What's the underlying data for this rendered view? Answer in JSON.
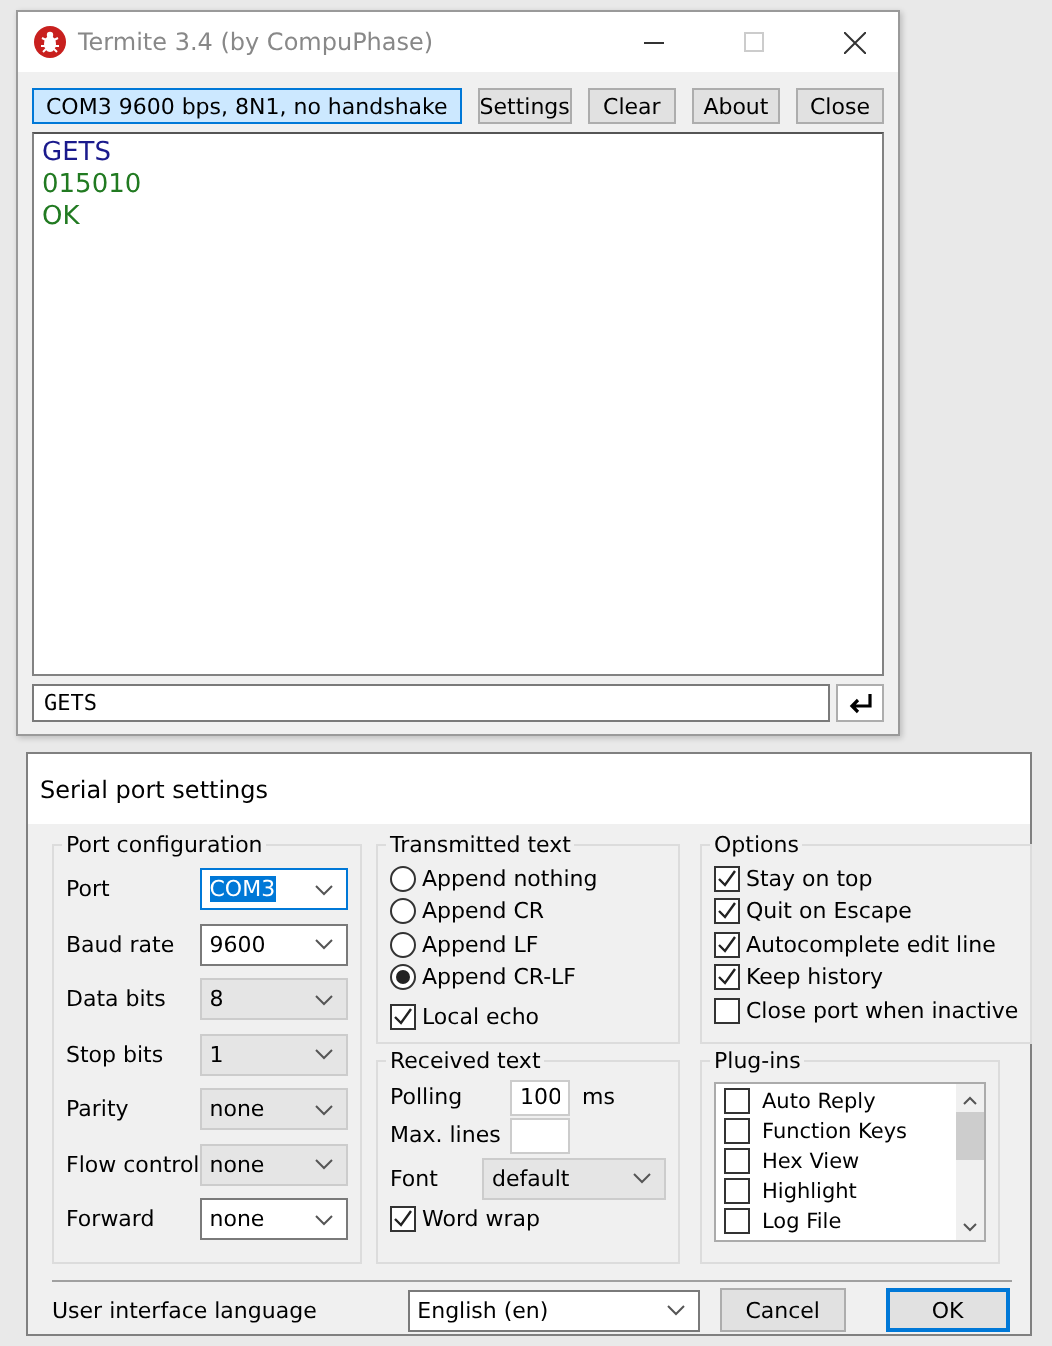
{
  "window": {
    "title": "Termite 3.4 (by CompuPhase)"
  },
  "toolbar": {
    "status": "COM3 9600 bps, 8N1, no handshake",
    "buttons": [
      "Settings",
      "Clear",
      "About",
      "Close"
    ]
  },
  "terminal": {
    "lines": [
      {
        "text": "GETS",
        "kind": "sent"
      },
      {
        "text": "015010",
        "kind": "received"
      },
      {
        "text": "OK",
        "kind": "received"
      }
    ]
  },
  "input": {
    "value": "GETS"
  },
  "dialog": {
    "title": "Serial port settings",
    "port_configuration": {
      "title": "Port configuration",
      "fields": [
        {
          "label": "Port",
          "value": "COM3",
          "disabled": false,
          "selected": true
        },
        {
          "label": "Baud rate",
          "value": "9600",
          "disabled": false,
          "selected": false
        },
        {
          "label": "Data bits",
          "value": "8",
          "disabled": true,
          "selected": false
        },
        {
          "label": "Stop bits",
          "value": "1",
          "disabled": true,
          "selected": false
        },
        {
          "label": "Parity",
          "value": "none",
          "disabled": true,
          "selected": false
        },
        {
          "label": "Flow control",
          "value": "none",
          "disabled": true,
          "selected": false
        },
        {
          "label": "Forward",
          "value": "none",
          "disabled": false,
          "selected": false
        }
      ]
    },
    "transmitted_text": {
      "title": "Transmitted text",
      "options": [
        {
          "label": "Append nothing",
          "selected": false
        },
        {
          "label": "Append CR",
          "selected": false
        },
        {
          "label": "Append LF",
          "selected": false
        },
        {
          "label": "Append CR-LF",
          "selected": true
        }
      ],
      "local_echo": {
        "label": "Local echo",
        "checked": true
      }
    },
    "received_text": {
      "title": "Received text",
      "polling_label": "Polling",
      "polling_value": "100",
      "polling_unit": "ms",
      "max_lines_label": "Max. lines",
      "font_label": "Font",
      "font_value": "default",
      "font_disabled": true,
      "word_wrap": {
        "label": "Word wrap",
        "checked": true
      }
    },
    "options": {
      "title": "Options",
      "items": [
        {
          "label": "Stay on top",
          "checked": true
        },
        {
          "label": "Quit on Escape",
          "checked": true
        },
        {
          "label": "Autocomplete edit line",
          "checked": true
        },
        {
          "label": "Keep history",
          "checked": true
        },
        {
          "label": "Close port when inactive",
          "checked": false
        }
      ]
    },
    "plugins": {
      "title": "Plug-ins",
      "items": [
        {
          "label": "Auto Reply",
          "checked": false
        },
        {
          "label": "Function Keys",
          "checked": false
        },
        {
          "label": "Hex View",
          "checked": false
        },
        {
          "label": "Highlight",
          "checked": false
        },
        {
          "label": "Log File",
          "checked": false
        }
      ]
    },
    "language": {
      "label": "User interface language",
      "value": "English (en)"
    },
    "buttons": [
      {
        "label": "Cancel",
        "default": false
      },
      {
        "label": "OK",
        "default": true
      }
    ]
  }
}
